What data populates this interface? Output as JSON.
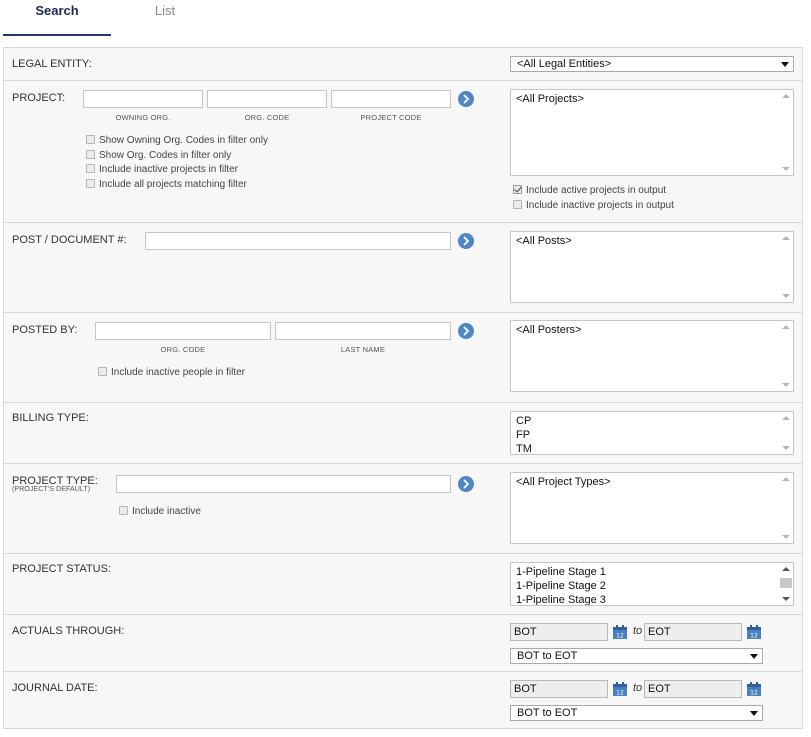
{
  "tabs": [
    {
      "label": "Search",
      "active": true
    },
    {
      "label": "List",
      "active": false
    }
  ],
  "legal_entity": {
    "label": "LEGAL ENTITY:",
    "select_value": "<All Legal Entities>"
  },
  "project": {
    "label": "PROJECT:",
    "captions": [
      "OWNING ORG.",
      "ORG. CODE",
      "PROJECT CODE"
    ],
    "checkboxes": [
      {
        "label": "Show Owning Org. Codes in filter only",
        "checked": false
      },
      {
        "label": "Show Org. Codes in filter only",
        "checked": false
      },
      {
        "label": "Include inactive projects in filter",
        "checked": false
      },
      {
        "label": "Include all projects matching filter",
        "checked": false
      }
    ],
    "list_items": [
      "<All Projects>"
    ],
    "output_checkboxes": [
      {
        "label": "Include active projects in output",
        "checked": true
      },
      {
        "label": "Include inactive projects in output",
        "checked": false
      }
    ]
  },
  "post_document": {
    "label": "POST / DOCUMENT #:",
    "list_items": [
      "<All Posts>"
    ]
  },
  "posted_by": {
    "label": "POSTED BY:",
    "captions": [
      "ORG. CODE",
      "LAST NAME"
    ],
    "checkbox": {
      "label": "Include inactive people in filter",
      "checked": false
    },
    "list_items": [
      "<All Posters>"
    ]
  },
  "billing_type": {
    "label": "BILLING TYPE:",
    "list_items": [
      "CP",
      "FP",
      "TM"
    ]
  },
  "project_type": {
    "label": "PROJECT TYPE:",
    "sublabel": "(PROJECT'S DEFAULT)",
    "checkbox": {
      "label": "Include inactive",
      "checked": false
    },
    "list_items": [
      "<All Project Types>"
    ]
  },
  "project_status": {
    "label": "PROJECT STATUS:",
    "list_items": [
      "1-Pipeline Stage 1",
      "1-Pipeline Stage 2",
      "1-Pipeline Stage 3"
    ]
  },
  "actuals_through": {
    "label": "ACTUALS THROUGH:",
    "from": "BOT",
    "to_word": "to",
    "to": "EOT",
    "range_select": "BOT to EOT"
  },
  "journal_date": {
    "label": "JOURNAL DATE:",
    "from": "BOT",
    "to_word": "to",
    "to": "EOT",
    "range_select": "BOT to EOT"
  },
  "colors": {
    "accent": "#4f86c6",
    "active_tab": "#1a2a55",
    "calendar": "#4a7fc0"
  },
  "icons": [
    "chevron-right-icon",
    "calendar-icon",
    "chevron-down-icon",
    "checkmark-icon"
  ]
}
